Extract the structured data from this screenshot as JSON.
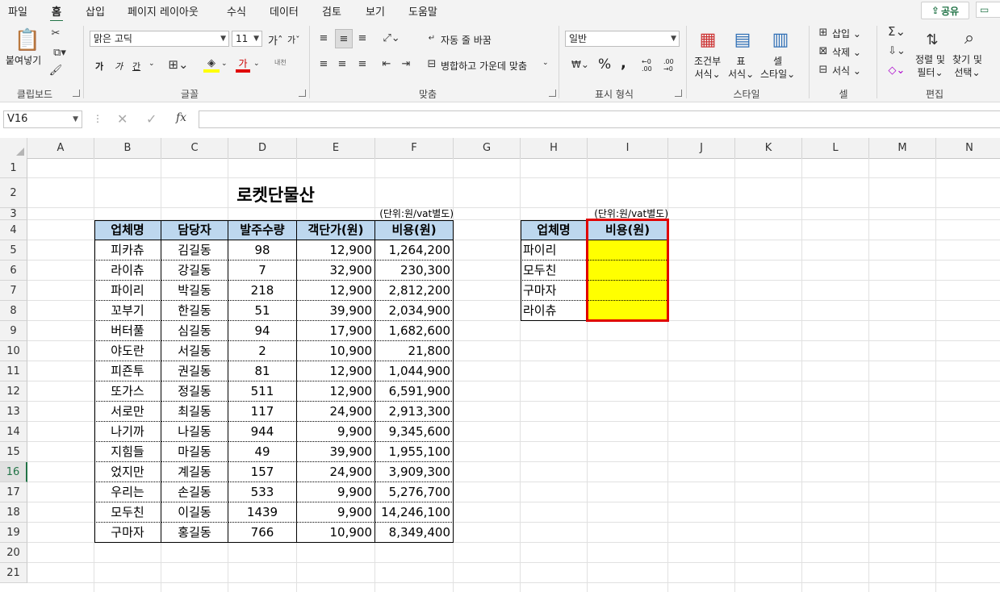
{
  "ribbon_tabs": [
    "파일",
    "홈",
    "삽입",
    "페이지 레이아웃",
    "수식",
    "데이터",
    "검토",
    "보기",
    "도움말"
  ],
  "share_label": "공유",
  "ribbon": {
    "clipboard": {
      "paste": "붙여넣기",
      "group": "클립보드"
    },
    "font": {
      "name": "맑은 고딕",
      "size": "11",
      "bold": "가",
      "italic": "가",
      "underline": "간",
      "grow": "가",
      "shrink": "가",
      "phonetic": "내천",
      "font_color_glyph": "가",
      "group": "글꼴"
    },
    "alignment": {
      "wrap": "자동 줄 바꿈",
      "merge": "병합하고 가운데 맞춤",
      "group": "맞춤"
    },
    "number": {
      "format": "일반",
      "group": "표시 형식",
      "percent": "%",
      "comma": ",",
      "inc_decimal": "←0 .00",
      "dec_decimal": ".00 →0"
    },
    "styles": {
      "conditional": [
        "조건부",
        "서식"
      ],
      "table": [
        "표",
        "서식"
      ],
      "cell": [
        "셀",
        "스타일"
      ],
      "group": "스타일"
    },
    "cells": {
      "insert": "삽입",
      "delete": "삭제",
      "format": "서식",
      "group": "셀"
    },
    "editing": {
      "sort": [
        "정렬 및",
        "필터"
      ],
      "find": [
        "찾기 및",
        "선택"
      ],
      "group": "편집"
    }
  },
  "formula_bar": {
    "name_box": "V16",
    "fx": "fx",
    "value": ""
  },
  "columns": [
    "A",
    "B",
    "C",
    "D",
    "E",
    "F",
    "G",
    "H",
    "I",
    "J",
    "K",
    "L",
    "M",
    "N"
  ],
  "rows": [
    "1",
    "2",
    "3",
    "4",
    "5",
    "6",
    "7",
    "8",
    "9",
    "10",
    "11",
    "12",
    "13",
    "14",
    "15",
    "16",
    "17",
    "18",
    "19",
    "20",
    "21"
  ],
  "selected_row": "16",
  "sheet": {
    "title": "로켓단물산",
    "unit_note_left": "(단위:원/vat별도)",
    "unit_note_right": "(단위:원/vat별도)",
    "main_table": {
      "headers": [
        "업체명",
        "담당자",
        "발주수량",
        "객단가(원)",
        "비용(원)"
      ],
      "rows": [
        [
          "피카츄",
          "김길동",
          "98",
          "12,900",
          "1,264,200"
        ],
        [
          "라이츄",
          "강길동",
          "7",
          "32,900",
          "230,300"
        ],
        [
          "파이리",
          "박길동",
          "218",
          "12,900",
          "2,812,200"
        ],
        [
          "꼬부기",
          "한길동",
          "51",
          "39,900",
          "2,034,900"
        ],
        [
          "버터풀",
          "심길동",
          "94",
          "17,900",
          "1,682,600"
        ],
        [
          "야도란",
          "서길동",
          "2",
          "10,900",
          "21,800"
        ],
        [
          "피죤투",
          "권길동",
          "81",
          "12,900",
          "1,044,900"
        ],
        [
          "또가스",
          "정길동",
          "511",
          "12,900",
          "6,591,900"
        ],
        [
          "서로만",
          "최길동",
          "117",
          "24,900",
          "2,913,300"
        ],
        [
          "나기까",
          "나길동",
          "944",
          "9,900",
          "9,345,600"
        ],
        [
          "지힘들",
          "마길동",
          "49",
          "39,900",
          "1,955,100"
        ],
        [
          "었지만",
          "계길동",
          "157",
          "24,900",
          "3,909,300"
        ],
        [
          "우리는",
          "손길동",
          "533",
          "9,900",
          "5,276,700"
        ],
        [
          "모두친",
          "이길동",
          "1439",
          "9,900",
          "14,246,100"
        ],
        [
          "구마자",
          "홍길동",
          "766",
          "10,900",
          "8,349,400"
        ]
      ]
    },
    "summary_table": {
      "headers": [
        "업체명",
        "비용(원)"
      ],
      "rows": [
        [
          "파이리",
          ""
        ],
        [
          "모두친",
          ""
        ],
        [
          "구마자",
          ""
        ],
        [
          "라이츄",
          ""
        ]
      ]
    }
  },
  "colors": {
    "header_fill": "#bdd7ee",
    "highlight_fill": "#ffff00",
    "highlight_border": "#e00000",
    "accent": "#217346"
  }
}
